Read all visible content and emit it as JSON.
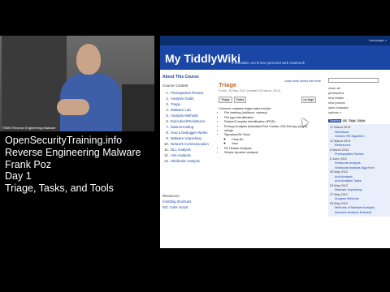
{
  "video": {
    "lower_third": "TSNIS Reverse Engineering Malware"
  },
  "caption": {
    "line1": "OpenSecurityTraining.info",
    "line2": "Reverse Engineering Malware",
    "line3": "Frank Poz",
    "line4": "Day 1",
    "line5": "Triage, Tasks, and Tools"
  },
  "browser": {
    "topbar_right": "backstage »",
    "site_title": "My TiddlyWiki",
    "site_subtitle": "a reusable non-linear personal web notebook",
    "menu": {
      "heading": "About This Course",
      "section": "Course Content",
      "items": [
        {
          "n": "1.",
          "label": "Prerequisites Review"
        },
        {
          "n": "2.",
          "label": "Analysis Goals"
        },
        {
          "n": "3.",
          "label": "Triage"
        },
        {
          "n": "4.",
          "label": "Malware Lab"
        },
        {
          "n": "5.",
          "label": "Analysis Methods"
        },
        {
          "n": "6.",
          "label": "Execution/Persistence"
        },
        {
          "n": "7.",
          "label": "Data Encoding"
        },
        {
          "n": "8.",
          "label": "How a Debugger Works"
        },
        {
          "n": "9.",
          "label": "Malware Unpacking"
        },
        {
          "n": "10.",
          "label": "Network Communication"
        },
        {
          "n": "11.",
          "label": "DLL Analysis"
        },
        {
          "n": "12.",
          "label": "Anti-Analysis"
        },
        {
          "n": "13.",
          "label": "Shellcode Analysis"
        }
      ],
      "resources_heading": "Resources",
      "resources": [
        "ImmDbg Shortcuts",
        "IDC Color Script"
      ]
    },
    "tiddler": {
      "tools": "close  close others  edit  more",
      "title": "Triage",
      "meta": "Frank, 26 May 2012 (created 26 March 2012)",
      "tag1": "Triage",
      "tag2": "Tasks",
      "tagbox": "no tags",
      "intro": "Common malware triage tasks include:",
      "bullets": [
        "File hashing (md5sum, ssdeep)",
        "File type identification",
        "Packer/Compiler Identification (PEiD)",
        "Entropy Analysis (Mandiant Red Curtain, IDA Entropy plugin)",
        "strings",
        "Signature/AV Scan",
        "PE Header Analysis",
        "Simple dynamic analysis"
      ],
      "sub_bullets": [
        "Clam AV",
        "Yara"
      ]
    },
    "sidebar": {
      "options": [
        "close all",
        "permaview",
        "new tiddler",
        "new journal",
        "save changes",
        "options »"
      ],
      "tabs": [
        "Timeline",
        "All",
        "Tags",
        "More"
      ],
      "timeline": [
        {
          "d": "27 March 2013",
          "t": [
            "Workflows",
            "Generic RE Algorithm"
          ]
        },
        {
          "d": "12 March 2013",
          "t": [
            "References"
          ]
        },
        {
          "d": "6 March 2013",
          "t": [
            "Prerequisites Review"
          ]
        },
        {
          "d": "5 June 2012",
          "t": [
            "Shellcode Analysis",
            "Shellcode Analysis Egg Hunt"
          ]
        },
        {
          "d": "30 May 2012",
          "t": [
            "Anti-Analysis",
            "Anti-Analysis Tasks"
          ]
        },
        {
          "d": "29 May 2012",
          "t": [
            "Malware Unpacking"
          ]
        },
        {
          "d": "27 May 2012",
          "t": [
            "Analysis Methods"
          ]
        },
        {
          "d": "26 May 2012",
          "t": [
            "Methods of Malware Analysis",
            "Dynamic Analysis Example"
          ]
        }
      ]
    }
  }
}
